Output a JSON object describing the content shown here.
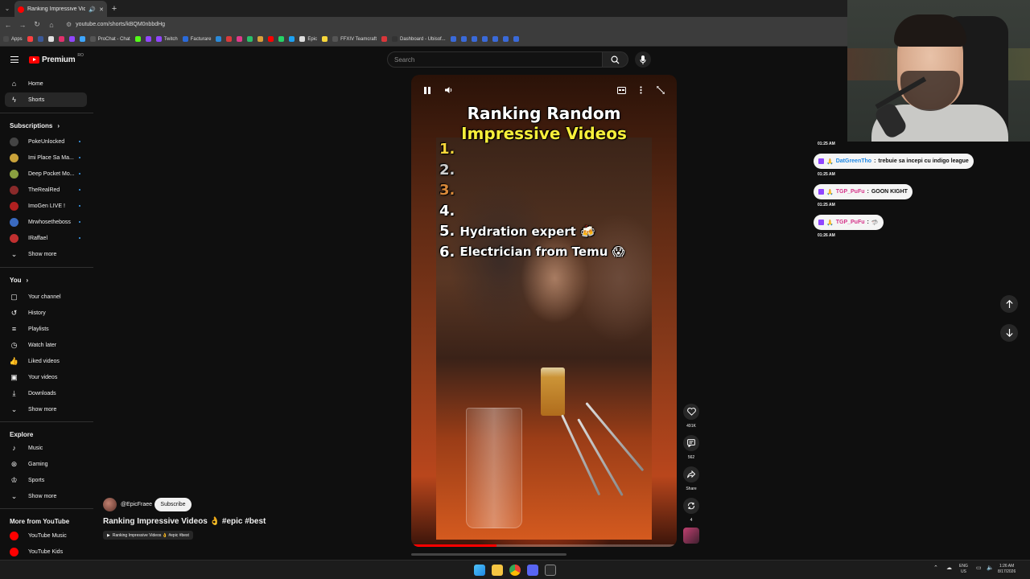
{
  "browser": {
    "tab_title": "Ranking Impressive Videos",
    "url": "youtube.com/shorts/kBQM0nbbdHg",
    "bookmarks": [
      {
        "label": "Apps",
        "color": "#4a4a4a"
      },
      {
        "label": "",
        "color": "#ff4040"
      },
      {
        "label": "",
        "color": "#3b5998"
      },
      {
        "label": "",
        "color": "#e0e0e0"
      },
      {
        "label": "",
        "color": "#e1306c"
      },
      {
        "label": "",
        "color": "#9146ff"
      },
      {
        "label": "",
        "color": "#3ea6ff"
      },
      {
        "label": "ProChat - Chat",
        "color": "#555"
      },
      {
        "label": "",
        "color": "#53fc18"
      },
      {
        "label": "",
        "color": "#9146ff"
      },
      {
        "label": "Twitch",
        "color": "#9146ff"
      },
      {
        "label": "Facturare",
        "color": "#2a6ad9"
      },
      {
        "label": "",
        "color": "#2a8ad9"
      },
      {
        "label": "",
        "color": "#d93a3a"
      },
      {
        "label": "",
        "color": "#e03a8a"
      },
      {
        "label": "",
        "color": "#2ac06a"
      },
      {
        "label": "",
        "color": "#d9a03a"
      },
      {
        "label": "",
        "color": "#ff0000"
      },
      {
        "label": "",
        "color": "#25d366"
      },
      {
        "label": "",
        "color": "#1da1f2"
      },
      {
        "label": "Epic",
        "color": "#ddd"
      },
      {
        "label": "",
        "color": "#f7d63a"
      },
      {
        "label": "FFXIV Teamcraft",
        "color": "#555"
      },
      {
        "label": "",
        "color": "#d9363a"
      },
      {
        "label": "Dashboard - Ubisof...",
        "color": "#333"
      },
      {
        "label": "",
        "color": "#3a6ad9"
      },
      {
        "label": "",
        "color": "#3a6ad9"
      },
      {
        "label": "",
        "color": "#3a6ad9"
      },
      {
        "label": "",
        "color": "#3a6ad9"
      },
      {
        "label": "",
        "color": "#3a6ad9"
      },
      {
        "label": "",
        "color": "#3a6ad9"
      },
      {
        "label": "",
        "color": "#3a6ad9"
      }
    ]
  },
  "header": {
    "logo_text": "Premium",
    "region": "RO",
    "search_placeholder": "Search"
  },
  "sidebar": {
    "main": [
      {
        "label": "Home",
        "icon": "home-icon"
      },
      {
        "label": "Shorts",
        "icon": "shorts-icon"
      }
    ],
    "subscriptions_title": "Subscriptions",
    "subscriptions": [
      {
        "label": "PokeUnlocked",
        "color": "#444"
      },
      {
        "label": "Imi Place Sa Ma...",
        "color": "#c9a23a"
      },
      {
        "label": "Deep Pocket Mo...",
        "color": "#8aa040"
      },
      {
        "label": "TheRealRed",
        "color": "#8a2a2a"
      },
      {
        "label": "ImoGen LIVE !",
        "color": "#b02020"
      },
      {
        "label": "Mrwhosetheboss",
        "color": "#3a6ac0"
      },
      {
        "label": "IRaffael",
        "color": "#c03030"
      }
    ],
    "show_more": "Show more",
    "you_title": "You",
    "you_items": [
      {
        "label": "Your channel",
        "icon": "channel-icon"
      },
      {
        "label": "History",
        "icon": "history-icon"
      },
      {
        "label": "Playlists",
        "icon": "playlists-icon"
      },
      {
        "label": "Watch later",
        "icon": "clock-icon"
      },
      {
        "label": "Liked videos",
        "icon": "thumbs-up-icon"
      },
      {
        "label": "Your videos",
        "icon": "video-icon"
      },
      {
        "label": "Downloads",
        "icon": "download-icon"
      }
    ],
    "explore_title": "Explore",
    "explore_items": [
      {
        "label": "Music",
        "icon": "music-icon"
      },
      {
        "label": "Gaming",
        "icon": "gaming-icon"
      },
      {
        "label": "Sports",
        "icon": "trophy-icon"
      }
    ],
    "more_title": "More from YouTube",
    "more_items": [
      {
        "label": "YouTube Music",
        "color": "#ff0000"
      },
      {
        "label": "YouTube Kids",
        "color": "#ff0000"
      }
    ]
  },
  "video": {
    "title_line1": "Ranking Random",
    "title_line2": "Impressive Videos",
    "ranks": [
      {
        "num": "1.",
        "text": ""
      },
      {
        "num": "2.",
        "text": ""
      },
      {
        "num": "3.",
        "text": ""
      },
      {
        "num": "4.",
        "text": ""
      },
      {
        "num": "5.",
        "text": "Hydration expert 🍻"
      },
      {
        "num": "6.",
        "text": "Electrician from Temu 😱"
      }
    ],
    "progress": 0.32,
    "channel": "@EpicFraee",
    "subscribe": "Subscribe",
    "caption": "Ranking Impressive Videos 👌 #epic #best",
    "playlist_chip": "Ranking Impressive Videos 👌 #epic #best"
  },
  "actions": {
    "likes": "491K",
    "comments": "562",
    "share": "Share",
    "remix": "4"
  },
  "chat": [
    {
      "time": "01:25 AM"
    },
    {
      "user": "DatGreenTho",
      "text": "trebuie sa incepi cu indigo league",
      "time": "01:25 AM",
      "user_color": "blue"
    },
    {
      "user": "TGP_PuFu",
      "text": "GOON KIGHT",
      "time": "01:25 AM",
      "user_color": "pink"
    },
    {
      "user": "TGP_PuFu",
      "text": "🦈",
      "time": "01:26 AM",
      "user_color": "pink"
    }
  ],
  "taskbar": {
    "lang": "ENG",
    "locale": "US",
    "time": "1:26 AM",
    "date": "8/17/2026"
  }
}
